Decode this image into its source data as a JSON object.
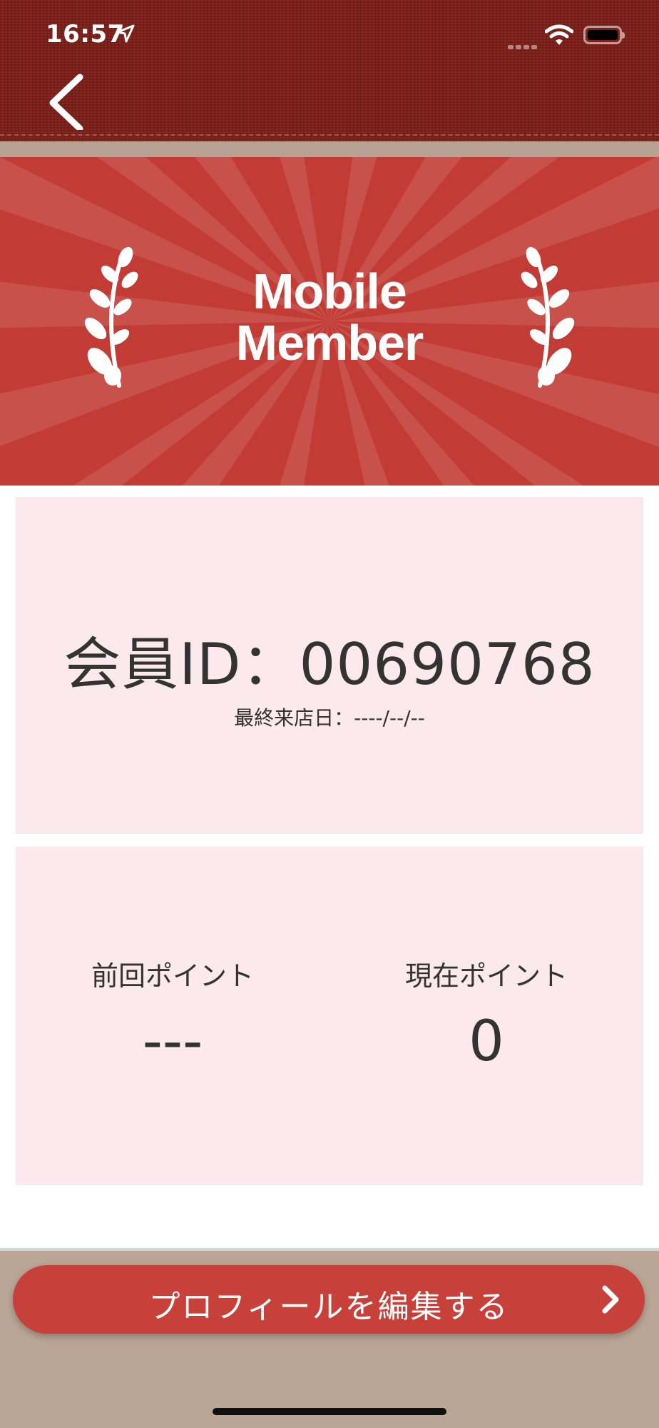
{
  "status_bar": {
    "time": "16:57"
  },
  "header": {
    "back_icon": "chevron-left-icon"
  },
  "banner": {
    "title_line1": "Mobile",
    "title_line2": "Member"
  },
  "member_card": {
    "member_id": "会員ID：00690768",
    "last_visit": "最終来店日：----/--/--"
  },
  "points_card": {
    "previous_label": "前回ポイント",
    "previous_value": "---",
    "current_label": "現在ポイント",
    "current_value": "0"
  },
  "footer": {
    "edit_profile_label": "プロフィールを編集する"
  },
  "colors": {
    "header_bg": "#7d1d16",
    "banner_red": "#c23c35",
    "card_pink": "#fbe9ed",
    "button_red": "#c8403a",
    "footer_bg": "#bba596"
  }
}
